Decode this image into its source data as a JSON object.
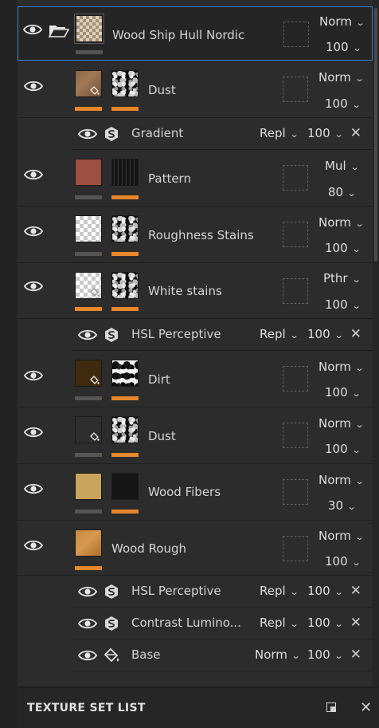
{
  "colors": {
    "accent_orange": "#e8862a",
    "selection_blue": "#3f7fd0",
    "panel_bg": "#2c2c2c"
  },
  "layers": [
    {
      "name": "Wood Ship Hull Nordic",
      "type": "folder",
      "blend": "Norm",
      "opacity": "100",
      "selected": true
    },
    {
      "name": "Dust",
      "blend": "Norm",
      "opacity": "100"
    },
    {
      "name": "Pattern",
      "blend": "Mul",
      "opacity": "80"
    },
    {
      "name": "Roughness Stains",
      "blend": "Norm",
      "opacity": "100"
    },
    {
      "name": "White stains",
      "blend": "Pthr",
      "opacity": "100"
    },
    {
      "name": "Dirt",
      "blend": "Norm",
      "opacity": "100"
    },
    {
      "name": "Dust",
      "blend": "Norm",
      "opacity": "100"
    },
    {
      "name": "Wood Fibers",
      "blend": "Norm",
      "opacity": "30"
    },
    {
      "name": "Wood Rough",
      "blend": "Norm",
      "opacity": "100"
    }
  ],
  "effects": [
    {
      "name": "Gradient",
      "icon": "substance-filter-icon",
      "blend": "Repl",
      "opacity": "100"
    },
    {
      "name": "HSL Perceptive",
      "icon": "substance-filter-icon",
      "blend": "Repl",
      "opacity": "100"
    },
    {
      "name": "HSL Perceptive",
      "icon": "substance-filter-icon",
      "blend": "Repl",
      "opacity": "100"
    },
    {
      "name": "Contrast Lumino...",
      "icon": "substance-filter-icon",
      "blend": "Repl",
      "opacity": "100"
    },
    {
      "name": "Base",
      "icon": "fill-bucket-icon",
      "blend": "Norm",
      "opacity": "100"
    }
  ],
  "footer": {
    "title": "TEXTURE SET LIST"
  }
}
